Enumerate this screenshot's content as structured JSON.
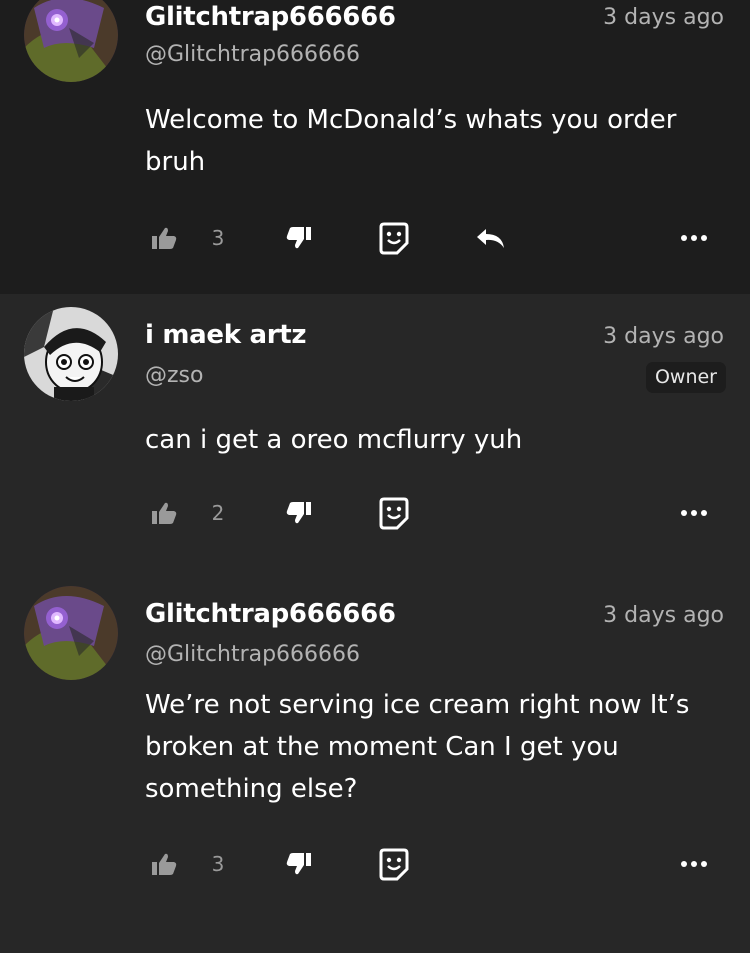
{
  "colors": {
    "background": "#272727",
    "highlighted_comment_bg": "#1d1d1d",
    "text_primary": "#ffffff",
    "text_secondary": "#b3b3b3",
    "icon": "#ffffff",
    "icon_muted": "#9a9a9a"
  },
  "comments": [
    {
      "author": "Glitchtrap666666",
      "handle": "@Glitchtrap666666",
      "time": "3 days ago",
      "text": "Welcome to McDonald’s whats you order bruh",
      "likes": "3",
      "avatar_icon": "glitchtrap-avatar",
      "has_reply_button": true
    },
    {
      "author": "i maek artz",
      "handle": "@zso",
      "time": "3 days ago",
      "badge": "Owner",
      "text": "can i get a oreo mcflurry yuh",
      "likes": "2",
      "avatar_icon": "cartoon-character-avatar"
    },
    {
      "author": "Glitchtrap666666",
      "handle": "@Glitchtrap666666",
      "time": "3 days ago",
      "text": "We’re not serving ice cream right now It’s broken at the moment Can I get you something else?",
      "likes": "3",
      "avatar_icon": "glitchtrap-avatar"
    }
  ],
  "action_icons": [
    "thumbs-up-icon",
    "thumbs-down-icon",
    "emoji-reaction-icon",
    "reply-icon",
    "more-options-icon"
  ]
}
